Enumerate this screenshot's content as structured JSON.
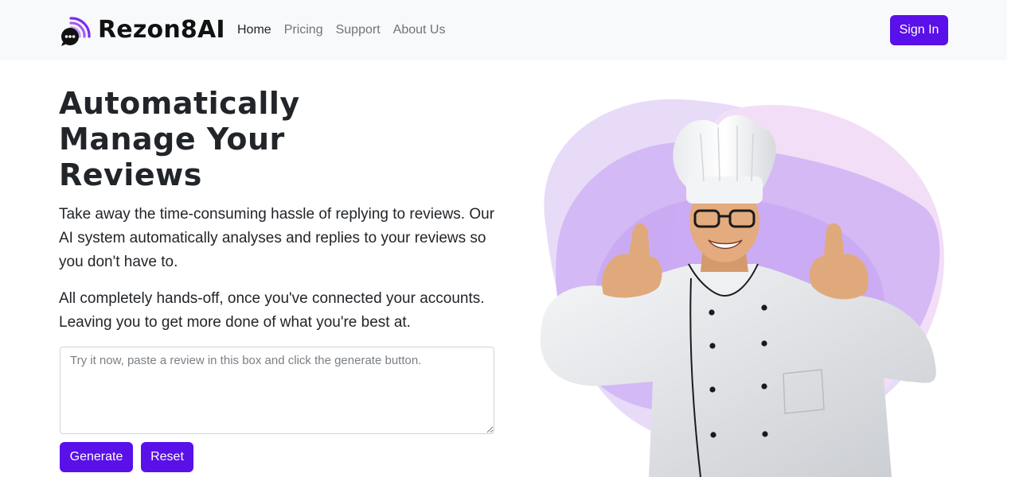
{
  "brand": {
    "name": "Rezon8AI",
    "icon": "chat-signal-icon"
  },
  "nav": {
    "items": [
      {
        "label": "Home",
        "active": true
      },
      {
        "label": "Pricing",
        "active": false
      },
      {
        "label": "Support",
        "active": false
      },
      {
        "label": "About Us",
        "active": false
      }
    ],
    "sign_in_label": "Sign In"
  },
  "hero": {
    "title": "Automatically Manage Your Reviews",
    "paragraph_1": "Take away the time-consuming hassle of replying to reviews. Our AI system automatically analyses and replies to your reviews so you don't have to.",
    "paragraph_2": "All completely hands-off, once you've connected your accounts. Leaving you to get more done of what you're best at.",
    "review_input": {
      "value": "",
      "placeholder": "Try it now, paste a review in this box and click the generate button."
    },
    "generate_label": "Generate",
    "reset_label": "Reset",
    "image_subject": "chef-thumbs-up-illustration"
  },
  "colors": {
    "accent": "#5a10e8",
    "navbar_bg": "#f8f9fa",
    "blob_light": "#e5d8f7",
    "blob_mid": "#cdb0f3",
    "blob_pink": "#f1dcf5"
  }
}
